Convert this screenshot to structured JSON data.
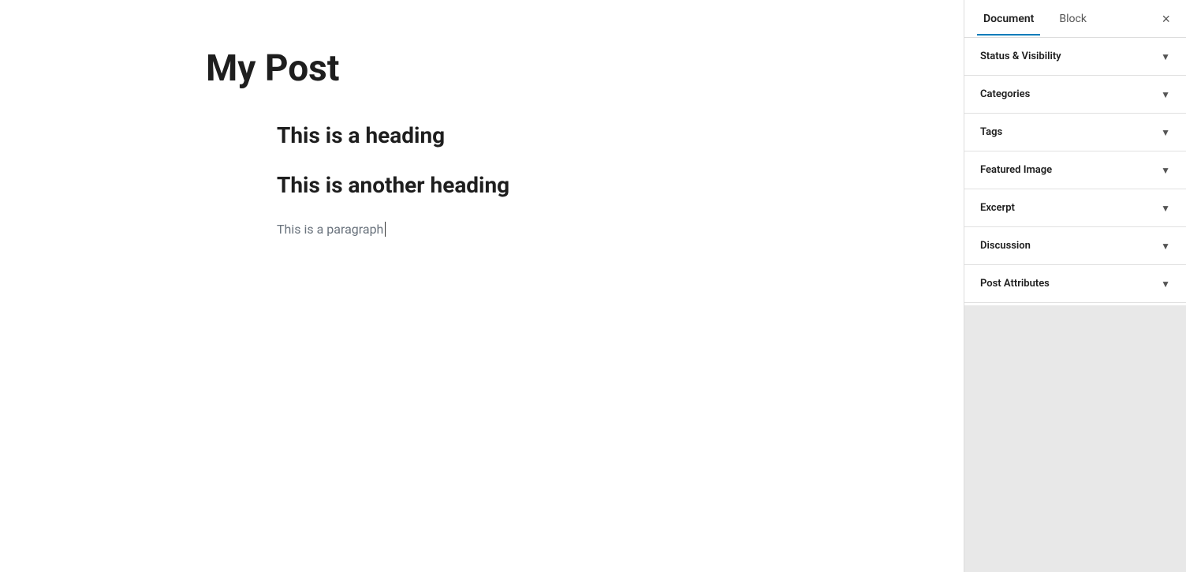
{
  "editor": {
    "post_title": "My Post",
    "heading1": "This is a heading",
    "heading2": "This is another heading",
    "paragraph": "This is a paragraph"
  },
  "sidebar": {
    "tab_document": "Document",
    "tab_block": "Block",
    "close_label": "×",
    "panels": [
      {
        "id": "status-visibility",
        "label": "Status & Visibility"
      },
      {
        "id": "categories",
        "label": "Categories"
      },
      {
        "id": "tags",
        "label": "Tags"
      },
      {
        "id": "featured-image",
        "label": "Featured Image"
      },
      {
        "id": "excerpt",
        "label": "Excerpt"
      },
      {
        "id": "discussion",
        "label": "Discussion"
      },
      {
        "id": "post-attributes",
        "label": "Post Attributes"
      }
    ],
    "chevron": "▼"
  }
}
